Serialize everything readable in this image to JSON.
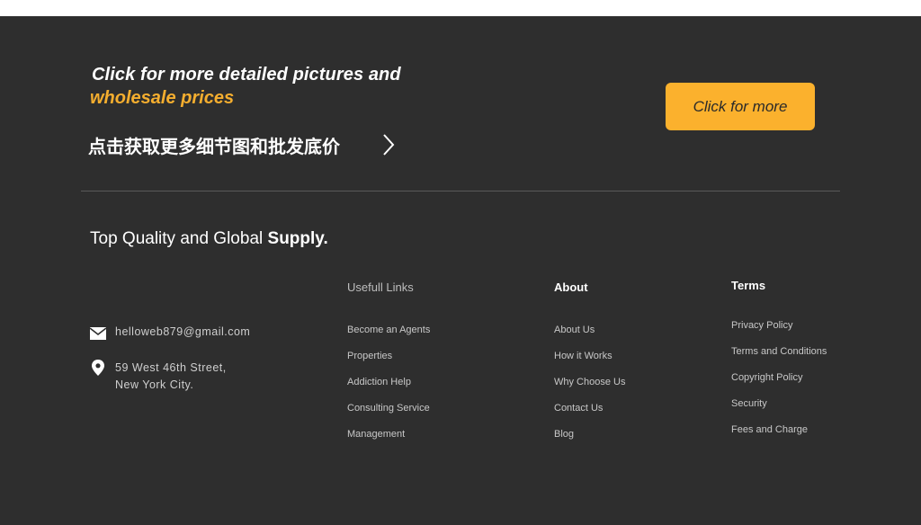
{
  "cta": {
    "line1": "Click for more detailed pictures and",
    "line2": "wholesale prices",
    "chinese": "点击获取更多细节图和批发底价",
    "button_label": "Click for more"
  },
  "tagline": {
    "regular": "Top Quality and Global ",
    "bold": "Supply."
  },
  "contact": {
    "email": "helloweb879@gmail.com",
    "address_line1": "59 West 46th Street,",
    "address_line2": "New York City."
  },
  "columns": {
    "useful": {
      "heading": "Usefull Links",
      "links": [
        "Become an Agents",
        "Properties",
        "Addiction Help",
        "Consulting Service",
        "Management"
      ]
    },
    "about": {
      "heading": "About",
      "links": [
        "About Us",
        "How it Works",
        "Why Choose Us",
        "Contact Us",
        "Blog"
      ]
    },
    "terms": {
      "heading": "Terms",
      "links": [
        "Privacy Policy",
        "Terms and Conditions",
        "Copyright Policy",
        "Security",
        "Fees and Charge"
      ]
    }
  },
  "colors": {
    "background": "#2e2e2e",
    "accent": "#fbb12d",
    "accent_text": "#f5ae2f"
  },
  "icons": {
    "email": "envelope-icon",
    "address": "map-pin-icon",
    "arrow": "chevron-right-icon"
  }
}
